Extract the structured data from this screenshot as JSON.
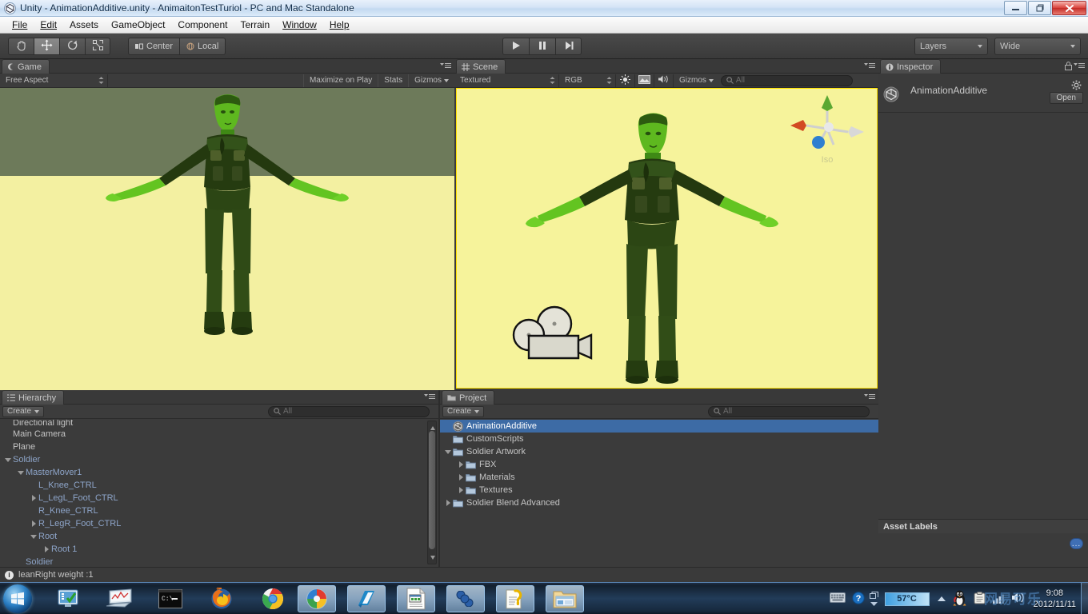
{
  "window": {
    "title": "Unity - AnimationAdditive.unity - AnimaitonTestTuriol - PC and Mac Standalone",
    "app_icon": "unity-icon",
    "minimize": "minimize-icon",
    "restore": "restore-icon",
    "close": "close-icon"
  },
  "menubar": {
    "items": [
      "File",
      "Edit",
      "Assets",
      "GameObject",
      "Component",
      "Terrain",
      "Window",
      "Help"
    ]
  },
  "toolbar": {
    "tools": [
      {
        "name": "hand-tool",
        "icon": "hand-icon",
        "active": false
      },
      {
        "name": "move-tool",
        "icon": "move-icon",
        "active": true
      },
      {
        "name": "rotate-tool",
        "icon": "rotate-icon",
        "active": false
      },
      {
        "name": "scale-tool",
        "icon": "scale-icon",
        "active": false
      }
    ],
    "pivot_label": "Center",
    "rotation_label": "Local",
    "play_label": "play-icon",
    "pause_label": "pause-icon",
    "step_label": "step-icon",
    "layers_label": "Layers",
    "layout_label": "Wide"
  },
  "game_view": {
    "tab_label": "Game",
    "aspect": "Free Aspect",
    "maximize_on_play": "Maximize on Play",
    "stats": "Stats",
    "gizmos": "Gizmos",
    "sky_color": "#6d7a5a",
    "ground_color": "#f2f0a0"
  },
  "scene_view": {
    "tab_label": "Scene",
    "draw_mode": "Textured",
    "color_mode": "RGB",
    "lighting_icon": "sun-icon",
    "skybox_icon": "image-icon",
    "audio_icon": "speaker-icon",
    "gizmos": "Gizmos",
    "search_placeholder": "All",
    "gizmo_axis_label": "Iso",
    "background_color": "#f6f39b",
    "border_color": "#ffe100"
  },
  "hierarchy": {
    "tab_label": "Hierarchy",
    "create_label": "Create",
    "search_placeholder": "All",
    "items": [
      {
        "label": "Directional light",
        "depth": 0,
        "twisty": "none",
        "prefab": false,
        "clipped": true
      },
      {
        "label": "Main Camera",
        "depth": 0,
        "twisty": "none",
        "prefab": false
      },
      {
        "label": "Plane",
        "depth": 0,
        "twisty": "none",
        "prefab": false
      },
      {
        "label": "Soldier",
        "depth": 0,
        "twisty": "down",
        "prefab": true
      },
      {
        "label": "MasterMover1",
        "depth": 1,
        "twisty": "down",
        "prefab": true
      },
      {
        "label": "L_Knee_CTRL",
        "depth": 2,
        "twisty": "none",
        "prefab": true
      },
      {
        "label": "L_LegL_Foot_CTRL",
        "depth": 2,
        "twisty": "right",
        "prefab": true
      },
      {
        "label": "R_Knee_CTRL",
        "depth": 2,
        "twisty": "none",
        "prefab": true
      },
      {
        "label": "R_LegR_Foot_CTRL",
        "depth": 2,
        "twisty": "right",
        "prefab": true
      },
      {
        "label": "Root",
        "depth": 2,
        "twisty": "down",
        "prefab": true
      },
      {
        "label": "Root 1",
        "depth": 3,
        "twisty": "right",
        "prefab": true
      },
      {
        "label": "Soldier",
        "depth": 1,
        "twisty": "none",
        "prefab": true
      }
    ]
  },
  "project": {
    "tab_label": "Project",
    "create_label": "Create",
    "search_placeholder": "All",
    "items": [
      {
        "label": "AnimationAdditive",
        "depth": 0,
        "twisty": "none",
        "icon": "unity-scene-icon",
        "selected": true
      },
      {
        "label": "CustomScripts",
        "depth": 0,
        "twisty": "none",
        "icon": "folder-icon",
        "selected": false
      },
      {
        "label": "Soldier Artwork",
        "depth": 0,
        "twisty": "down",
        "icon": "folder-icon",
        "selected": false
      },
      {
        "label": "FBX",
        "depth": 1,
        "twisty": "right",
        "icon": "folder-icon",
        "selected": false
      },
      {
        "label": "Materials",
        "depth": 1,
        "twisty": "right",
        "icon": "folder-icon",
        "selected": false
      },
      {
        "label": "Textures",
        "depth": 1,
        "twisty": "right",
        "icon": "folder-icon",
        "selected": false
      },
      {
        "label": "Soldier Blend Advanced",
        "depth": 0,
        "twisty": "right",
        "icon": "folder-icon",
        "selected": false
      }
    ],
    "selection_color": "#3d6ba5"
  },
  "inspector": {
    "tab_label": "Inspector",
    "lock_icon": "lock-icon",
    "asset_name": "AnimationAdditive",
    "asset_icon": "unity-scene-icon",
    "settings_icon": "gear-icon",
    "open_label": "Open",
    "asset_labels_title": "Asset Labels",
    "label_button": "..."
  },
  "statusbar": {
    "message": "leanRight weight :1",
    "icon": "info-icon"
  },
  "taskbar": {
    "start": "windows-start-orb",
    "pinned": [
      {
        "name": "taskbar-pin-display-settings",
        "icon": "monitor-check-icon"
      },
      {
        "name": "taskbar-pin-performance-monitor",
        "icon": "monitor-graph-icon"
      },
      {
        "name": "taskbar-pin-command-prompt",
        "icon": "console-icon"
      },
      {
        "name": "taskbar-pin-firefox",
        "icon": "firefox-icon"
      },
      {
        "name": "taskbar-pin-chrome",
        "icon": "chrome-icon"
      }
    ],
    "tasks": [
      {
        "name": "taskbar-task-maxthon",
        "icon": "maxthon-icon"
      },
      {
        "name": "taskbar-task-editor",
        "icon": "blue-editor-icon"
      },
      {
        "name": "taskbar-task-document",
        "icon": "document-icon"
      },
      {
        "name": "taskbar-task-unity",
        "icon": "unity-infinity-icon"
      },
      {
        "name": "taskbar-task-help",
        "icon": "help-doc-icon"
      },
      {
        "name": "taskbar-task-explorer",
        "icon": "folder-window-icon"
      }
    ],
    "tray": {
      "keyboard_icon": "keyboard-icon",
      "help_icon": "help-circle-icon",
      "expand_icon": "show-hidden-icons-icon",
      "temperature": "57°C",
      "qq_icon": "penguin-icon",
      "clipboard_icon": "clipboard-icon",
      "network_icon": "network-signal-icon",
      "volume_icon": "volume-icon"
    },
    "clock": {
      "time": "9:08",
      "date": "2012/11/11"
    },
    "watermark": "网易可乐"
  }
}
